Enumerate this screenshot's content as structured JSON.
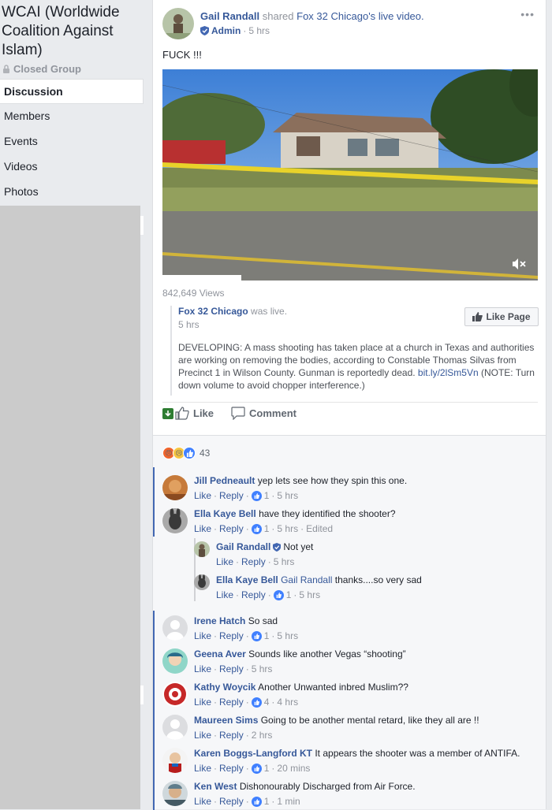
{
  "group": {
    "title": "WCAI (Worldwide Coalition Against Islam)",
    "privacy": "Closed Group",
    "nav": [
      "Discussion",
      "Members",
      "Events",
      "Videos",
      "Photos"
    ]
  },
  "post": {
    "author": "Gail Randall",
    "shared_text": "shared",
    "shared_page": "Fox 32 Chicago's",
    "shared_suffix": "live video.",
    "role": "Admin",
    "time": "5 hrs",
    "text": "FUCK !!!",
    "views": "842,649 Views",
    "shared": {
      "page": "Fox 32 Chicago",
      "status": "was live.",
      "time": "5 hrs",
      "description_start": "DEVELOPING: A mass shooting has taken place at a church in Texas and authorities are working on removing the bodies, according to Constable Thomas Silvas from Precinct 1 in Wilson County. Gunman is reportedly dead. ",
      "link": "bit.ly/2lSm5Vn",
      "description_end": " (NOTE: Turn down volume to avoid chopper interference.)",
      "like_page_label": "Like Page"
    },
    "actions": {
      "like": "Like",
      "comment": "Comment"
    },
    "reaction_count": "43"
  },
  "comments": [
    {
      "name": "Jill Pedneault",
      "text": "yep lets see how they spin this one.",
      "likes": "1",
      "time": "5 hrs",
      "edited": ""
    },
    {
      "name": "Ella Kaye Bell",
      "text": "have they identified the shooter?",
      "likes": "1",
      "time": "5 hrs",
      "edited": "Edited"
    },
    {
      "name": "Gail Randall",
      "text": "Not yet",
      "likes": "",
      "time": "5 hrs",
      "edited": ""
    },
    {
      "name": "Ella Kaye Bell",
      "mention": "Gail Randall",
      "text": "thanks....so very sad",
      "likes": "1",
      "time": "5 hrs",
      "edited": ""
    },
    {
      "name": "Irene Hatch",
      "text": "So sad",
      "likes": "1",
      "time": "5 hrs",
      "edited": ""
    },
    {
      "name": "Geena Aver",
      "text": "Sounds like another Vegas “shooting”",
      "likes": "",
      "time": "5 hrs",
      "edited": ""
    },
    {
      "name": "Kathy Woycik",
      "text": "Another Unwanted inbred Muslim??",
      "likes": "4",
      "time": "4 hrs",
      "edited": ""
    },
    {
      "name": "Maureen Sims",
      "text": "Going to be another mental retard, like they all are !!",
      "likes": "",
      "time": "2 hrs",
      "edited": ""
    },
    {
      "name": "Karen Boggs-Langford KT",
      "text": "It appears the shooter was a member of ANTIFA.",
      "likes": "1",
      "time": "20 mins",
      "edited": ""
    },
    {
      "name": "Ken West",
      "text": "Dishonourably Discharged from Air Force.",
      "likes": "1",
      "time": "1 min",
      "edited": ""
    }
  ],
  "labels": {
    "like": "Like",
    "reply": "Reply"
  },
  "colors": {
    "link": "#365899",
    "accent": "#4267b2",
    "like_blue": "#4080ff"
  }
}
